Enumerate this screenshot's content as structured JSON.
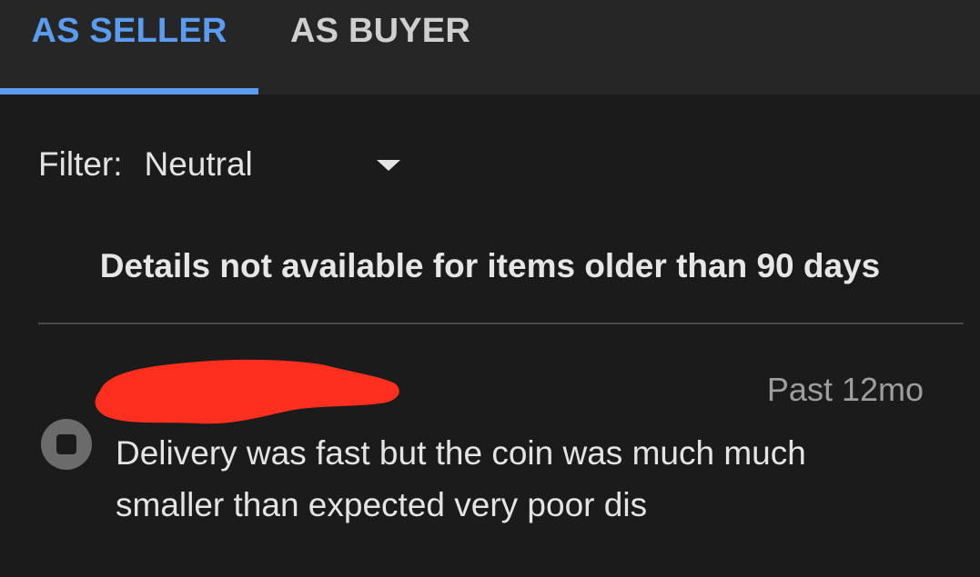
{
  "tabs": {
    "seller_label": "AS SELLER",
    "buyer_label": "AS BUYER",
    "active": "AS SELLER"
  },
  "filter": {
    "label": "Filter:",
    "value": "Neutral"
  },
  "notice": "Details not available for items older than 90 days",
  "feedback": {
    "time": "Past 12mo",
    "rating_icon": "neutral-rating-icon",
    "comment_line1": "Delivery was fast but the coin was much much",
    "comment_line2": "smaller than expected very poor dis"
  },
  "colors": {
    "accent": "#5b9bf0",
    "background": "#1b1b1b",
    "tabbar": "#262626",
    "redaction": "#ff2f1f"
  }
}
